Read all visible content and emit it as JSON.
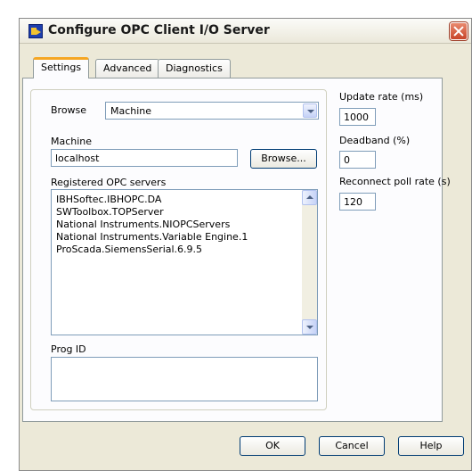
{
  "window": {
    "title": "Configure OPC Client I/O Server"
  },
  "tabs": [
    "Settings",
    "Advanced",
    "Diagnostics"
  ],
  "browse": {
    "label": "Browse",
    "value": "Machine"
  },
  "machine": {
    "label": "Machine",
    "value": "localhost",
    "browse_button": "Browse..."
  },
  "servers": {
    "label": "Registered OPC servers",
    "items": [
      "IBHSoftec.IBHOPC.DA",
      "SWToolbox.TOPServer",
      "National Instruments.NIOPCServers",
      "National Instruments.Variable Engine.1",
      "ProScada.SiemensSerial.6.9.5"
    ]
  },
  "prog_id": {
    "label": "Prog ID",
    "value": ""
  },
  "update_rate": {
    "label": "Update rate (ms)",
    "value": "1000"
  },
  "deadband": {
    "label": "Deadband (%)",
    "value": "0"
  },
  "reconnect": {
    "label": "Reconnect poll rate (s)",
    "value": "120"
  },
  "buttons": {
    "ok": "OK",
    "cancel": "Cancel",
    "help": "Help"
  }
}
